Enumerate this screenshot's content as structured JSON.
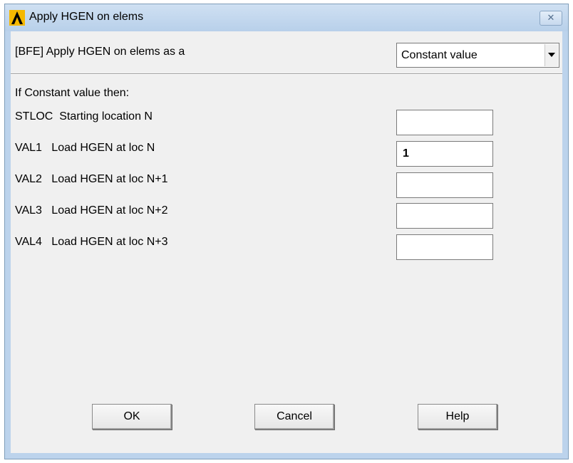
{
  "window": {
    "title": "Apply HGEN on elems",
    "close_glyph": "✕",
    "app_icon": "ansys-logo-icon",
    "accent_color": "#bcd3ec"
  },
  "header": {
    "label": "[BFE] Apply HGEN on elems as a",
    "dropdown": {
      "selected": "Constant value",
      "icon": "chevron-down-icon"
    }
  },
  "section": {
    "heading": "If Constant value then:"
  },
  "fields": [
    {
      "label": "STLOC  Starting location N",
      "value": ""
    },
    {
      "label": "VAL1   Load HGEN at loc N",
      "value": "1"
    },
    {
      "label": "VAL2   Load HGEN at loc N+1",
      "value": ""
    },
    {
      "label": "VAL3   Load HGEN at loc N+2",
      "value": ""
    },
    {
      "label": "VAL4   Load HGEN at loc N+3",
      "value": ""
    }
  ],
  "buttons": {
    "ok": "OK",
    "cancel": "Cancel",
    "help": "Help"
  }
}
